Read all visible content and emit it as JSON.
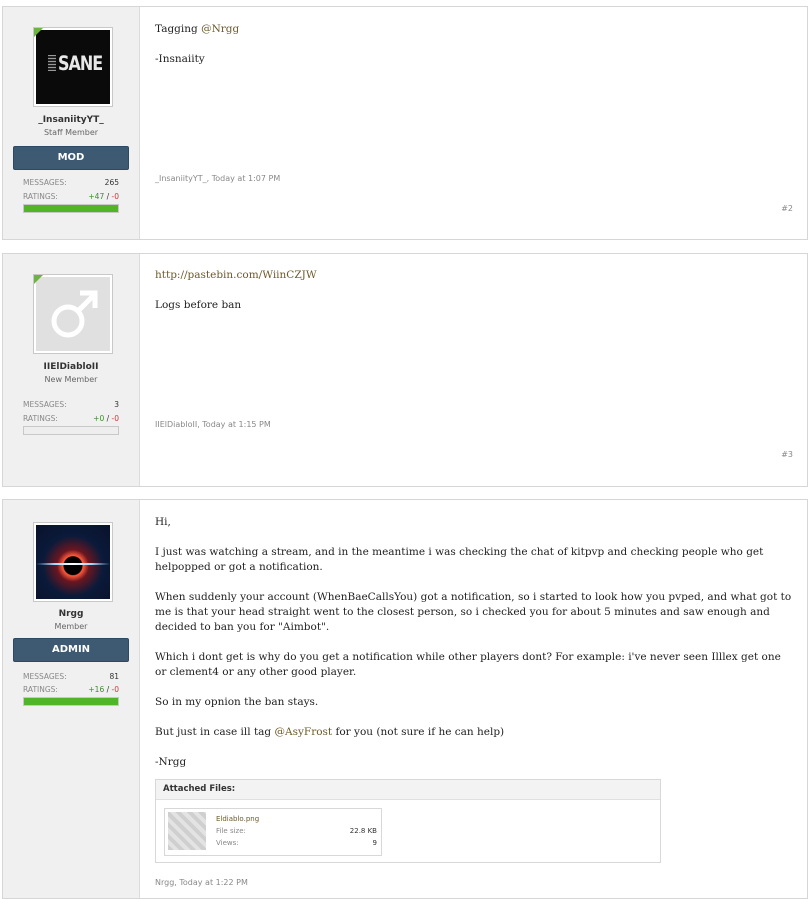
{
  "posts": [
    {
      "user": {
        "name": "_InsaniityYT_",
        "title": "Staff Member",
        "banner": "MOD",
        "messages": "265",
        "ratings_pos": "+47",
        "ratings_sep": " / ",
        "ratings_neg": "-0",
        "avatar_text": "SANE",
        "online": true
      },
      "stats_labels": {
        "messages": "MESSAGES:",
        "ratings": "RATINGS:"
      },
      "rating_fill_fraction": 1.0,
      "body": {
        "line1_pre": "Tagging ",
        "line1_mention": "@Nrgg",
        "line2": "-Insnaiity"
      },
      "meta": "_InsaniityYT_, Today at 1:07 PM",
      "permalink": "#2"
    },
    {
      "user": {
        "name": "IIElDiabloII",
        "title": "New Member",
        "messages": "3",
        "ratings_pos": "+0",
        "ratings_sep": " / ",
        "ratings_neg": "-0",
        "online": true
      },
      "stats_labels": {
        "messages": "MESSAGES:",
        "ratings": "RATINGS:"
      },
      "rating_fill_fraction": 0.0,
      "body": {
        "link": "http://pastebin.com/WiinCZJW",
        "line2": "Logs before ban"
      },
      "meta": "IIElDiabloII, Today at 1:15 PM",
      "permalink": "#3"
    },
    {
      "user": {
        "name": "Nrgg",
        "title": "Member",
        "banner": "ADMIN",
        "messages": "81",
        "ratings_pos": "+16",
        "ratings_sep": " / ",
        "ratings_neg": "-0"
      },
      "stats_labels": {
        "messages": "MESSAGES:",
        "ratings": "RATINGS:"
      },
      "rating_fill_fraction": 1.0,
      "body": {
        "p1": "Hi,",
        "p2": "I just was watching a stream, and in the meantime i was checking the chat of kitpvp and checking people who get helpopped or got a notification.",
        "p3": "When suddenly your account (WhenBaeCallsYou) got a notification, so i started to look how you pvped, and what got to me is that your head straight went to the closest person, so i checked you for about 5 minutes and saw enough and decided to ban you for \"Aimbot\".",
        "p4": "Which i dont get is why do you get a notification while other players dont? For example: i've never seen Illlex get one or clement4 or any other good player.",
        "p5": "So in my opnion the ban stays.",
        "p6_pre": "But just in case ill tag ",
        "p6_mention": "@AsyFrost",
        "p6_post": " for you (not sure if he can help)",
        "p7": "-Nrgg"
      },
      "attachments": {
        "header": "Attached Files:",
        "file": {
          "name": "Eldiablo.png",
          "size_label": "File size:",
          "size": "22.8 KB",
          "views_label": "Views:",
          "views": "9"
        }
      },
      "meta": "Nrgg, Today at 1:22 PM"
    }
  ],
  "colors": {
    "banner": "#3e5a73",
    "online": "#6cb33f",
    "rating_fill": "#52b527",
    "mention": "#6d5a2b"
  }
}
